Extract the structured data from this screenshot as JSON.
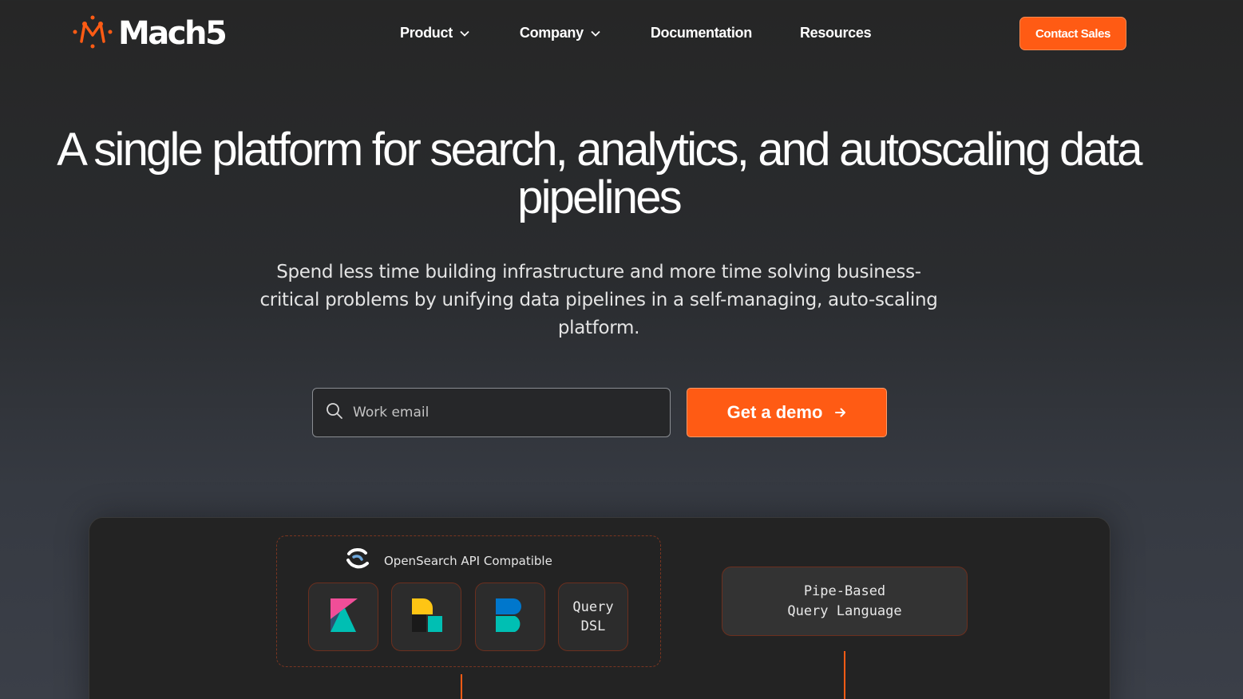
{
  "nav": {
    "logo_text": "Mach5",
    "items": [
      {
        "label": "Product",
        "has_dropdown": true
      },
      {
        "label": "Company",
        "has_dropdown": true
      },
      {
        "label": "Documentation",
        "has_dropdown": false
      },
      {
        "label": "Resources",
        "has_dropdown": false
      }
    ],
    "contact_label": "Contact Sales"
  },
  "hero": {
    "title": "A single platform for search, analytics, and autoscaling data pipelines",
    "subtitle": "Spend less time building infrastructure and more time solving business-critical problems by unifying data pipelines in a self-managing, auto-scaling platform.",
    "email_placeholder": "Work email",
    "demo_label": "Get a demo"
  },
  "diagram": {
    "opensearch_label": "OpenSearch API Compatible",
    "query_dsl_line1": "Query",
    "query_dsl_line2": "DSL",
    "pipe_line1": "Pipe-Based",
    "pipe_line2": "Query Language"
  },
  "colors": {
    "accent": "#ff5b14",
    "background": "#262626",
    "border_accent": "#6b2f1e"
  },
  "icons": {
    "logo": "mach5-molecule-icon",
    "search": "search-icon",
    "arrow": "arrow-right-icon",
    "chevron": "chevron-down-icon",
    "opensearch": "opensearch-icon",
    "kibana": "kibana-icon",
    "elastic": "elastic-icon",
    "beats": "beats-icon"
  }
}
